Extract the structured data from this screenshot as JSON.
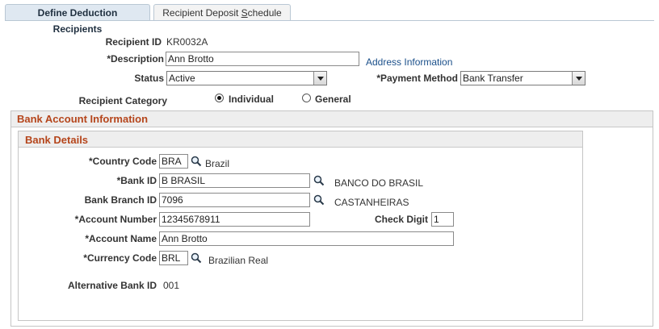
{
  "tabs": {
    "active": "Define Deduction Recipients",
    "inactive": "Recipient Deposit Schedule"
  },
  "header": {
    "recipient_id_label": "Recipient ID",
    "recipient_id_value": "KR0032A",
    "description_label": "*Description",
    "description_value": "Ann Brotto",
    "address_link": "Address Information",
    "status_label": "Status",
    "status_value": "Active",
    "payment_method_label": "*Payment Method",
    "payment_method_value": "Bank Transfer",
    "category_label": "Recipient Category",
    "category_options": [
      "Individual",
      "General"
    ]
  },
  "bank_account": {
    "title": "Bank Account Information"
  },
  "bank_details": {
    "title": "Bank Details",
    "country_code_label": "*Country Code",
    "country_code_value": "BRA",
    "country_name": "Brazil",
    "bank_id_label": "*Bank ID",
    "bank_id_value": "B BRASIL",
    "bank_name": "BANCO DO BRASIL",
    "branch_id_label": "Bank Branch ID",
    "branch_id_value": "7096",
    "branch_name": "CASTANHEIRAS",
    "account_number_label": "*Account Number",
    "account_number_value": "12345678911",
    "check_digit_label": "Check Digit",
    "check_digit_value": "1",
    "account_name_label": "*Account Name",
    "account_name_value": "Ann Brotto",
    "currency_code_label": "*Currency Code",
    "currency_code_value": "BRL",
    "currency_name": "Brazilian Real",
    "alt_bank_id_label": "Alternative Bank ID",
    "alt_bank_id_value": "001"
  },
  "colors": {
    "group_title": "#b5451b",
    "link": "#1a4f8a",
    "tab_active_bg": "#dfe8f1"
  },
  "icons": {
    "lookup": "magnifier-icon",
    "dropdown": "chevron-down-icon"
  }
}
